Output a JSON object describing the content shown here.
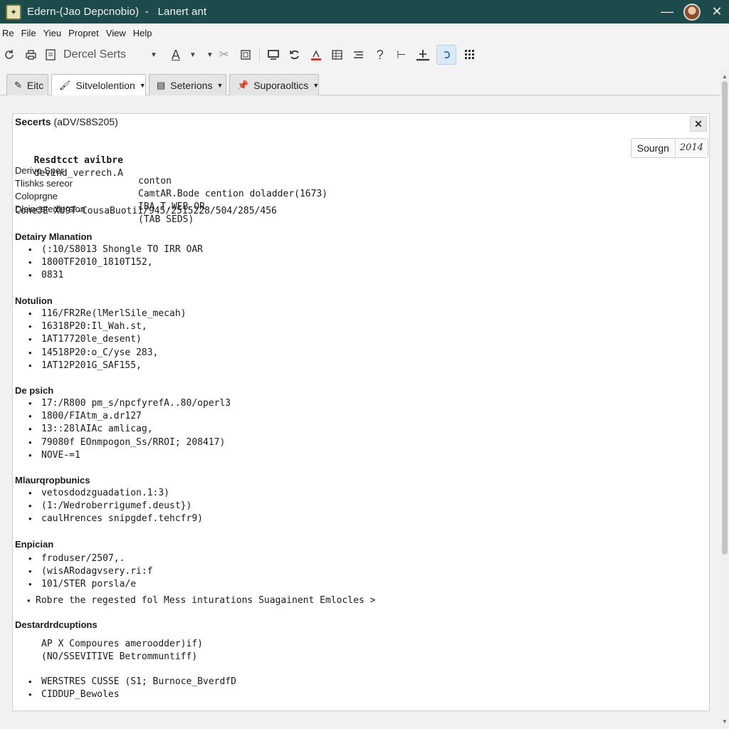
{
  "window": {
    "title": "Edern-(Jao Depcnobio)  -   Lanert ant",
    "minimize_icon": "minimize-icon",
    "close_icon": "close-icon"
  },
  "menu": {
    "items": [
      "Re",
      "File",
      "Yieu",
      "Propret",
      "View",
      "Help"
    ]
  },
  "toolbar": {
    "font_dropdown_value": "Dercel Serts",
    "icons": [
      "refresh-icon",
      "print-icon",
      "page-icon",
      "font-color-icon",
      "cut-icon",
      "frame-icon",
      "monitor-icon",
      "sync-icon",
      "highlight-icon",
      "table-icon",
      "list-icon",
      "help-icon",
      "indent-icon",
      "anchor-icon",
      "undo-icon",
      "grid-icon"
    ]
  },
  "tabs": [
    {
      "label": "Eitc",
      "icon": "pencil-icon"
    },
    {
      "label": "Sitvelolention",
      "icon": "brush-icon"
    },
    {
      "label": "Seterions",
      "icon": "list-icon"
    },
    {
      "label": "Suporaoltics",
      "icon": "pin-icon"
    }
  ],
  "panel": {
    "title_bold": "Secerts",
    "title_rest": "(aDV/S8S205)",
    "search": {
      "label": "Sourgn",
      "year": "2014"
    },
    "properties": {
      "head_bold": "Resdtcct avilbre",
      "head_rest": "devind_verrech.A",
      "rows": [
        {
          "key": "Derive Sper",
          "value": "conton"
        },
        {
          "key": "Tlishks sereor",
          "value": "CamtAR.Bode cention doladder(1673)"
        },
        {
          "key": "Coloprgne",
          "value": "IBA T.WEB OR"
        },
        {
          "key": "Dlsinestedlersion",
          "value": "(TAB SEDS)"
        }
      ],
      "long_row": "ConeJE XU9T-CousaBuoti1/945/2515228/504/285/456"
    },
    "sections": [
      {
        "title": "Detairy Mlanation",
        "items": [
          "(:10/S8013 Shongle TO IRR OAR",
          "1800TF2010_1810T152,",
          "0831"
        ]
      },
      {
        "title": "Notulion",
        "items": [
          "116/FR2Re(lMerlSile_mecah)",
          "16318P20:Il_Wah.st,",
          "1AT17720le_desent)",
          "14518P20:o_C/yse 283,",
          "1AT12P201G_SAF155,"
        ]
      },
      {
        "title": "De psich",
        "items": [
          "17:/R800 pm_s/npcfyrefA..80/operl3",
          "1800/FIAtm_a.dr127",
          "13::28lAIAc amlicag,",
          "79080f EOnmpogon_Ss/RROI; 208417)",
          "NOVE-=1"
        ]
      },
      {
        "title": "Mlaurqropbunics",
        "items": [
          "vetosdodzguadation.1:3)",
          "(1:/Wedroberrigumef.deust})",
          "caulHrences snipgdef.tehcfr9)"
        ]
      },
      {
        "title": "Enpician",
        "items": [
          "froduser/2507,.",
          "(wisARodagvsery.ri:f",
          "101/STER porsla/e"
        ]
      }
    ],
    "note": "Robre the regested fol Mess inturations Suagainent Emlocles >",
    "last_section": {
      "title": "Destardrdcuptions",
      "plain_lines": [
        "AP X Compoures ameroodder)if)",
        "(NO/SSEVITIVE Betrommuntiff)"
      ],
      "items": [
        "WERSTRES CUSSE (S1; Burnoce_BverdfD",
        "CIDDUP_Bewoles"
      ]
    }
  }
}
